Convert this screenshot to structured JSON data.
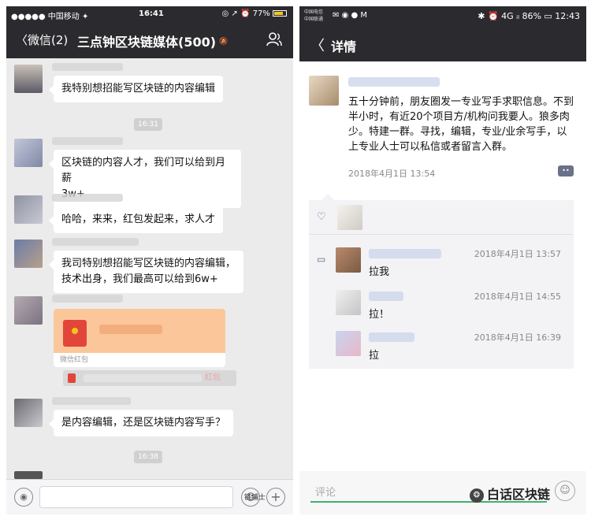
{
  "left": {
    "status": {
      "carrier": "●●●●● 中国移动 ✦",
      "time": "16:41",
      "right": "◎ ↗ ⏰ 77%"
    },
    "nav": {
      "back_label": "微信(2)",
      "title": "三点钟区块链媒体(500)",
      "mute": "🔕"
    },
    "messages": [
      {
        "text": "我特别想招能写区块链的内容编辑"
      },
      {
        "time": "16:31"
      },
      {
        "text": "区块链的内容人才，我们可以给到月薪\n3w+"
      },
      {
        "text": "哈哈，来来，红包发起来，求人才"
      },
      {
        "text": "我司特别想招能写区块链的内容编辑，\n技术出身，我们最高可以给到6w+"
      },
      {
        "redpacket_footer": "微信红包"
      },
      {
        "system_link": "红包"
      },
      {
        "text": "是内容编辑，还是区块链内容写手？"
      },
      {
        "time": "16:38"
      }
    ],
    "inputbar": {
      "voice": "◉",
      "emoji": "☺",
      "plus": "+"
    },
    "watermark": "链捕士"
  },
  "right": {
    "status": {
      "carrier": "中国电信\n中国联通",
      "notif": "✉ ◉ ● M",
      "right": "✱ ⏰ 4G ᵢₗ 86% ▭ 12:43"
    },
    "nav": {
      "back": "〈",
      "title": "详情"
    },
    "post": {
      "text": "五十分钟前，朋友圈发一专业写手求职信息。不到半小时，有近20个项目方/机构问我要人。狼多肉少。特建一群。寻找，编辑，专业/业余写手，以上专业人士可以私信或者留言入群。",
      "time": "2018年4月1日 13:54",
      "comment_icon": "••"
    },
    "comments": [
      {
        "time": "2018年4月1日 13:57",
        "text": "拉我"
      },
      {
        "time": "2018年4月1日 14:55",
        "text": "拉！"
      },
      {
        "time": "2018年4月1日 16:39",
        "text": "拉"
      }
    ],
    "inputbar": {
      "placeholder": "评论",
      "emoji": "☺"
    }
  },
  "watermark": {
    "icon": "❂",
    "text": "白话区块链"
  }
}
